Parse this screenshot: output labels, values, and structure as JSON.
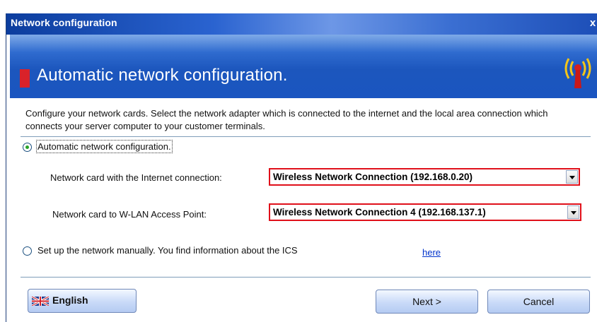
{
  "window": {
    "title": "Network configuration",
    "close_glyph": "x"
  },
  "header": {
    "title": "Automatic network configuration.",
    "icon": "wireless-antenna-icon"
  },
  "description": "Configure your network cards. Select the network adapter which is connected to the internet and the local area connection which connects your server computer to your customer terminals.",
  "options": {
    "automatic": {
      "label": "Automatic network configuration.",
      "selected": true
    },
    "manual": {
      "label": "Set up the network manually. You find information about the ICS",
      "link": "here",
      "selected": false
    }
  },
  "fields": {
    "internet": {
      "label": "Network card with the Internet connection:",
      "value": "Wireless Network Connection (192.168.0.20)"
    },
    "wlan": {
      "label": "Network card to W-LAN Access Point:",
      "value": "Wireless Network Connection 4 (192.168.137.1)"
    }
  },
  "footer": {
    "language_label": "English",
    "language_icon": "uk-flag-icon",
    "next_label": "Next >",
    "cancel_label": "Cancel"
  },
  "colors": {
    "title_blue": "#0c3d9e",
    "header_blue": "#1c56bd",
    "accent_red": "#d9222a",
    "highlight_border": "#e0101a",
    "radio_selected": "#28a328",
    "link": "#0033cc"
  }
}
